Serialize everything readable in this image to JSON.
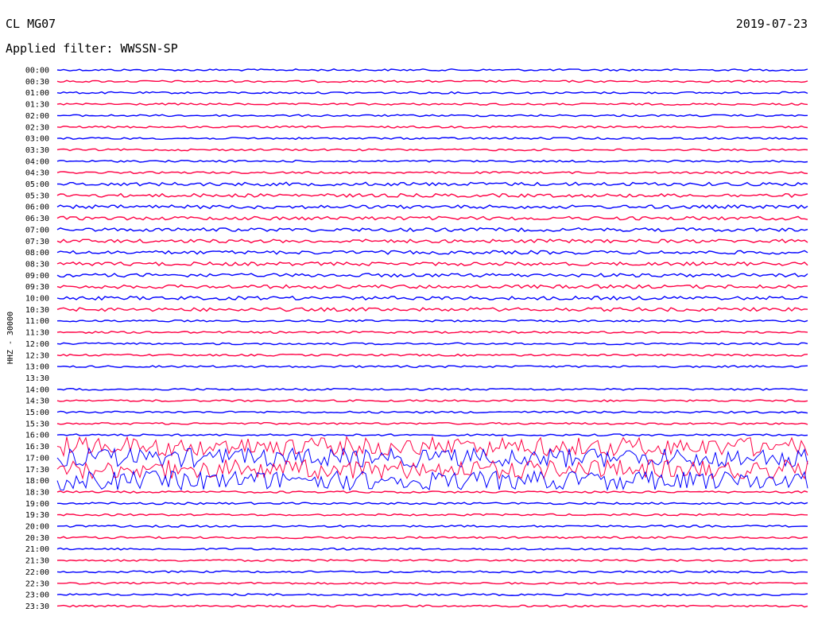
{
  "header": {
    "station": "CL MG07",
    "date": "2019-07-23",
    "filter": "Applied filter: WWSSN-SP"
  },
  "chart_data": {
    "type": "line",
    "ylabel": "HHZ - 30000",
    "trace_colors": [
      "#0000ff",
      "#ff0044"
    ],
    "rows": [
      {
        "time": "00:00",
        "has_data": true
      },
      {
        "time": "00:30",
        "has_data": true
      },
      {
        "time": "01:00",
        "has_data": true
      },
      {
        "time": "01:30",
        "has_data": true
      },
      {
        "time": "02:00",
        "has_data": true
      },
      {
        "time": "02:30",
        "has_data": true
      },
      {
        "time": "03:00",
        "has_data": true
      },
      {
        "time": "03:30",
        "has_data": true
      },
      {
        "time": "04:00",
        "has_data": true
      },
      {
        "time": "04:30",
        "has_data": true
      },
      {
        "time": "05:00",
        "has_data": true
      },
      {
        "time": "05:30",
        "has_data": true
      },
      {
        "time": "06:00",
        "has_data": true
      },
      {
        "time": "06:30",
        "has_data": true
      },
      {
        "time": "07:00",
        "has_data": true
      },
      {
        "time": "07:30",
        "has_data": true
      },
      {
        "time": "08:00",
        "has_data": true
      },
      {
        "time": "08:30",
        "has_data": true
      },
      {
        "time": "09:00",
        "has_data": true
      },
      {
        "time": "09:30",
        "has_data": true
      },
      {
        "time": "10:00",
        "has_data": true
      },
      {
        "time": "10:30",
        "has_data": true
      },
      {
        "time": "11:00",
        "has_data": true
      },
      {
        "time": "11:30",
        "has_data": true
      },
      {
        "time": "12:00",
        "has_data": true
      },
      {
        "time": "12:30",
        "has_data": true
      },
      {
        "time": "13:00",
        "has_data": true
      },
      {
        "time": "13:30",
        "has_data": false
      },
      {
        "time": "14:00",
        "has_data": true
      },
      {
        "time": "14:30",
        "has_data": true
      },
      {
        "time": "15:00",
        "has_data": true
      },
      {
        "time": "15:30",
        "has_data": true
      },
      {
        "time": "16:00",
        "has_data": true
      },
      {
        "time": "16:30",
        "has_data": true
      },
      {
        "time": "17:00",
        "has_data": true
      },
      {
        "time": "17:30",
        "has_data": true
      },
      {
        "time": "18:00",
        "has_data": true
      },
      {
        "time": "18:30",
        "has_data": true
      },
      {
        "time": "19:00",
        "has_data": true
      },
      {
        "time": "19:30",
        "has_data": true
      },
      {
        "time": "20:00",
        "has_data": true
      },
      {
        "time": "20:30",
        "has_data": true
      },
      {
        "time": "21:00",
        "has_data": true
      },
      {
        "time": "21:30",
        "has_data": true
      },
      {
        "time": "22:00",
        "has_data": true
      },
      {
        "time": "22:30",
        "has_data": true
      },
      {
        "time": "23:00",
        "has_data": true
      },
      {
        "time": "23:30",
        "has_data": true
      }
    ]
  }
}
